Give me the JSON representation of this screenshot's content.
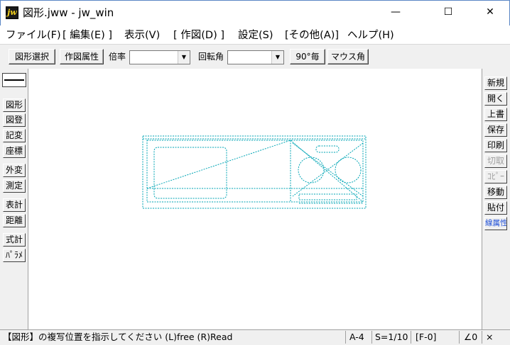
{
  "window": {
    "title": "図形.jww - jw_win",
    "app_icon_text": "jw",
    "minimize_glyph": "—",
    "maximize_glyph": "☐",
    "close_glyph": "✕"
  },
  "menu": [
    "ファイル(F)",
    "[ 編集(E) ]",
    "表示(V)",
    "[ 作図(D) ]",
    "設定(S)",
    "[その他(A)]",
    "ヘルプ(H)"
  ],
  "toolbar": {
    "select_figure_label": "図形選択",
    "figure_attr_label": "作図属性",
    "scale_label": "倍率",
    "scale_value": "",
    "rotation_label": "回転角",
    "rotation_value": "",
    "rotate90_label": "90°毎",
    "mouse_angle_label": "マウス角",
    "dropdown_arrow": "▼"
  },
  "left_tools": [
    "図形",
    "図登",
    "記変",
    "座標",
    "外変",
    "測定",
    "表計",
    "距離",
    "式計",
    "ﾊﾟﾗﾒ"
  ],
  "right_tools": [
    {
      "label": "新規",
      "state": "normal"
    },
    {
      "label": "開く",
      "state": "normal"
    },
    {
      "label": "上書",
      "state": "normal"
    },
    {
      "label": "保存",
      "state": "normal"
    },
    {
      "label": "印刷",
      "state": "normal"
    },
    {
      "label": "切取",
      "state": "disabled"
    },
    {
      "label": "ｺﾋﾟｰ",
      "state": "disabled"
    },
    {
      "label": "移動",
      "state": "normal"
    },
    {
      "label": "貼付",
      "state": "normal"
    },
    {
      "label": "線属性",
      "state": "highlight"
    }
  ],
  "drawing": {
    "line_color": "#00a5b5"
  },
  "status": {
    "message": "【図形】の複写位置を指示してください (L)free (R)Read",
    "paper": "A-4",
    "scale": "S=1/10",
    "layer": "[F-0]",
    "angle": "∠0",
    "close": "×"
  }
}
